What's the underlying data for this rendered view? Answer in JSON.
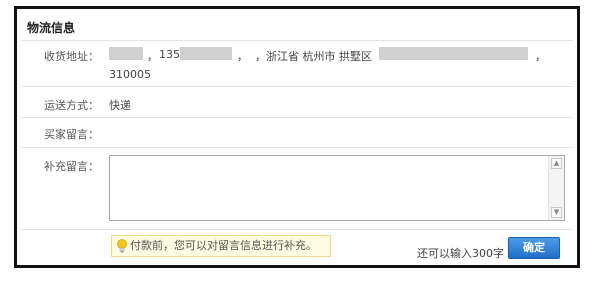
{
  "panel": {
    "title": "物流信息"
  },
  "address": {
    "label": "收货地址：",
    "comma1": "，",
    "phone_prefix": "135",
    "comma2": "，",
    "province_city": "，浙江省 杭州市 拱墅区",
    "comma3": "，",
    "postcode": "310005"
  },
  "shipping": {
    "label": "运送方式：",
    "value": "快递"
  },
  "buyer_message": {
    "label": "买家留言："
  },
  "supplement": {
    "label": "补充留言：",
    "value": ""
  },
  "footer": {
    "tip": "付款前，您可以对留言信息进行补充。",
    "remaining": "还可以输入300字",
    "confirm_label": "确定"
  },
  "colors": {
    "frame_border": "#111111",
    "button_blue": "#1f6fc9",
    "tip_background": "#fffbe0",
    "redacted": "#cfcfcf"
  },
  "icons": {
    "tip": "lightbulb-icon",
    "scroll_up": "arrow-up-icon",
    "scroll_down": "arrow-down-icon"
  }
}
